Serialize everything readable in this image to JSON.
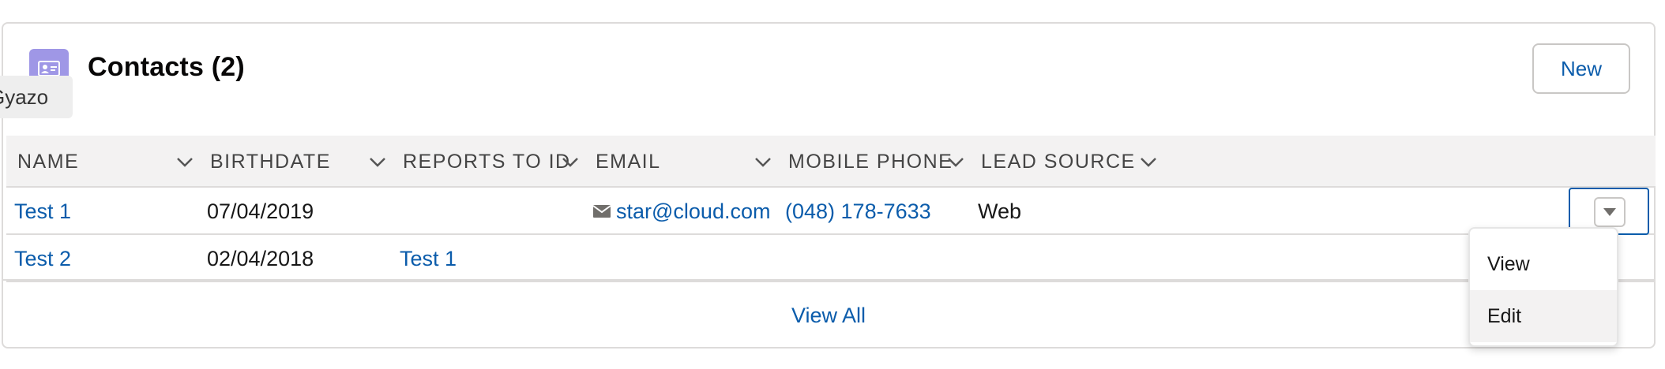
{
  "card": {
    "icon": "contact-card-icon",
    "title": "Contacts (2)",
    "new_label": "New",
    "accent": "#9f97e6"
  },
  "tooltip": {
    "text": "Gyazo"
  },
  "table": {
    "columns": [
      {
        "label": "NAME"
      },
      {
        "label": "BIRTHDATE"
      },
      {
        "label": "REPORTS TO ID"
      },
      {
        "label": "EMAIL"
      },
      {
        "label": "MOBILE PHONE"
      },
      {
        "label": "LEAD SOURCE"
      }
    ],
    "rows": [
      {
        "name": "Test 1",
        "birthdate": "07/04/2019",
        "reports_to": "",
        "email": "star@cloud.com",
        "mobile": "(048) 178-7633",
        "lead_source": "Web"
      },
      {
        "name": "Test 2",
        "birthdate": "02/04/2018",
        "reports_to": "Test 1",
        "email": "",
        "mobile": "",
        "lead_source": ""
      }
    ]
  },
  "footer": {
    "view_all": "View All"
  },
  "row_menu": {
    "items": [
      {
        "label": "View"
      },
      {
        "label": "Edit"
      }
    ],
    "hovered": "Edit"
  },
  "colors": {
    "link": "#0b5cab",
    "header_bg": "#f3f2f2",
    "border": "#dddbda"
  }
}
